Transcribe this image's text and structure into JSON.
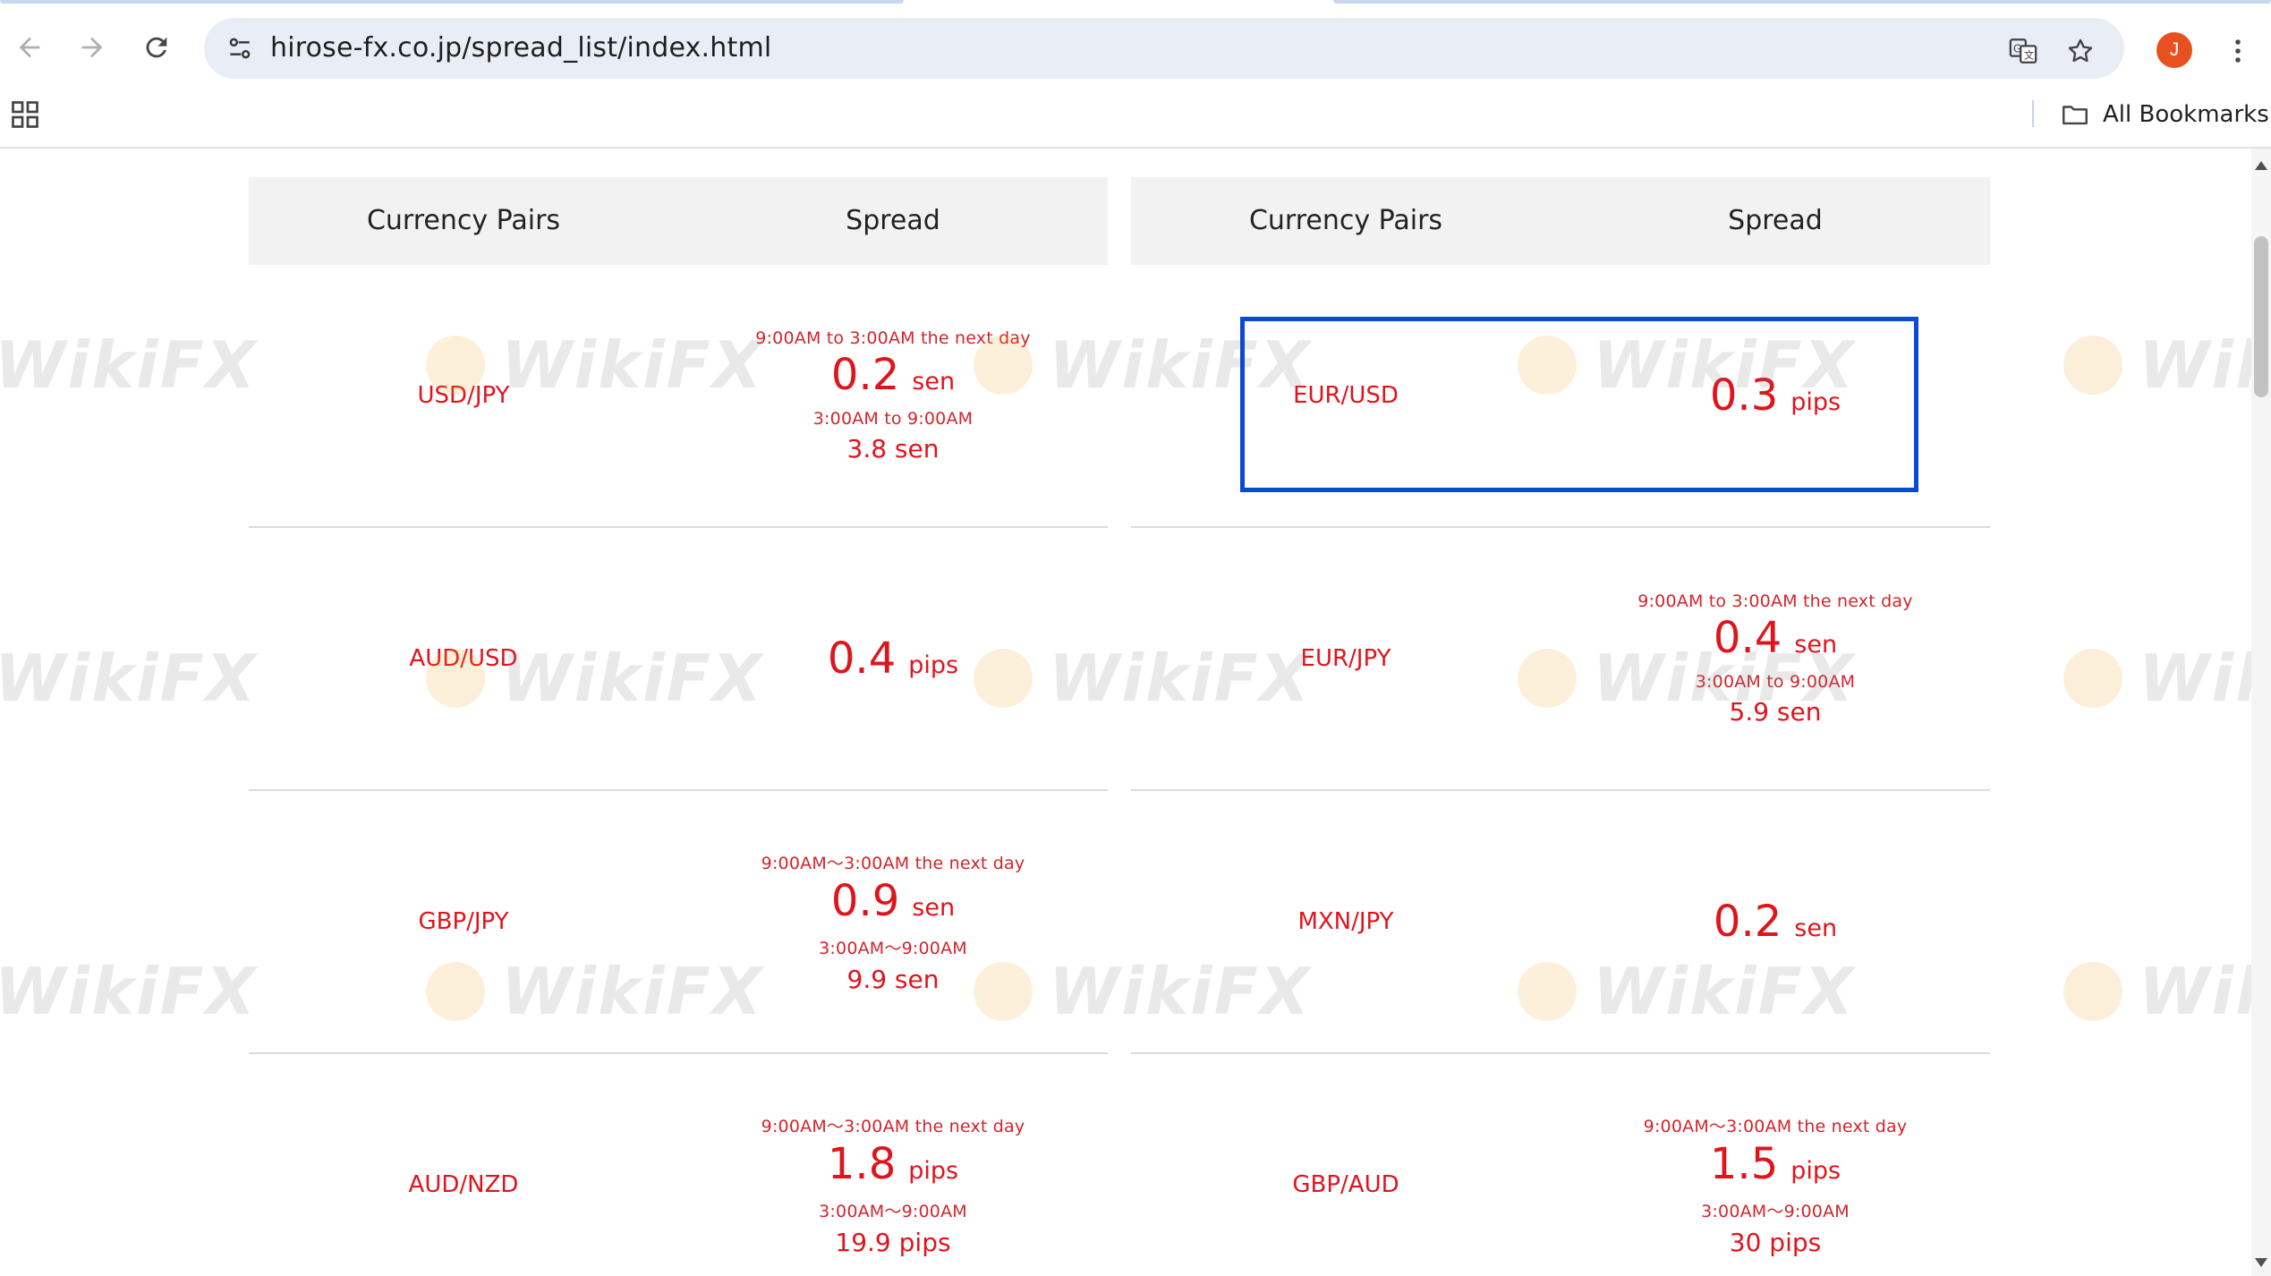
{
  "browser": {
    "url": "hirose-fx.co.jp/spread_list/index.html",
    "avatar_initial": "J",
    "bookmarks_label": "All Bookmarks",
    "icons": [
      "back-icon",
      "forward-icon",
      "reload-icon",
      "site-info-icon",
      "translate-icon",
      "star-icon",
      "menu-icon",
      "apps-icon",
      "folder-icon"
    ]
  },
  "table": {
    "header_pair": "Currency Pairs",
    "header_spread": "Spread"
  },
  "left_rows": [
    {
      "pair": "USD/JPY",
      "p1": "9:00AM to 3:00AM the next day",
      "v1": "0.2",
      "u1": "sen",
      "p2": "3:00AM to 9:00AM",
      "v2": "3.8 sen"
    },
    {
      "pair": "AUD/USD",
      "v1": "0.4",
      "u1": "pips"
    },
    {
      "pair": "GBP/JPY",
      "p1": "9:00AM〜3:00AM the next day",
      "v1": "0.9",
      "u1": "sen",
      "p2": "3:00AM〜9:00AM",
      "v2": "9.9 sen"
    },
    {
      "pair": "AUD/NZD",
      "p1": "9:00AM〜3:00AM the next day",
      "v1": "1.8",
      "u1": "pips",
      "p2": "3:00AM〜9:00AM",
      "v2": "19.9 pips"
    }
  ],
  "right_rows": [
    {
      "pair": "EUR/USD",
      "v1": "0.3",
      "u1": "pips"
    },
    {
      "pair": "EUR/JPY",
      "p1": "9:00AM to 3:00AM the next day",
      "v1": "0.4",
      "u1": "sen",
      "p2": "3:00AM to 9:00AM",
      "v2": "5.9 sen"
    },
    {
      "pair": "MXN/JPY",
      "v1": "0.2",
      "u1": "sen"
    },
    {
      "pair": "GBP/AUD",
      "p1": "9:00AM〜3:00AM the next day",
      "v1": "1.5",
      "u1": "pips",
      "p2": "3:00AM〜9:00AM",
      "v2": "30 pips"
    }
  ],
  "watermark": "WikiFX",
  "colors": {
    "accent_red": "#e0141c",
    "highlight_blue": "#0a49d6",
    "header_bg": "#f2f2f2"
  }
}
